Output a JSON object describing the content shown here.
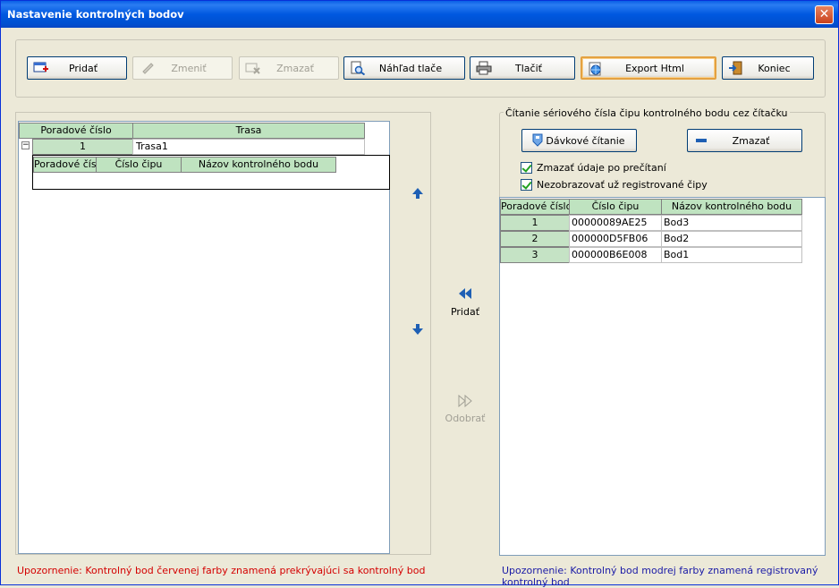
{
  "window": {
    "title": "Nastavenie kontrolných bodov"
  },
  "toolbar": {
    "add": "Pridať",
    "edit": "Zmeniť",
    "delete": "Zmazať",
    "preview": "Náhľad tlače",
    "print": "Tlačiť",
    "export": "Export Html",
    "exit": "Koniec"
  },
  "left_grid": {
    "headers": [
      "Poradové číslo",
      "Trasa"
    ],
    "rows": [
      {
        "index": "1",
        "route": "Trasa1"
      }
    ],
    "sub_headers": [
      "Poradové čís",
      "Číslo čipu",
      "Názov kontrolného bodu"
    ]
  },
  "middle": {
    "add_label": "Pridať",
    "remove_label": "Odobrať"
  },
  "reader": {
    "group_title": "Čítanie sériového čísla čipu kontrolného bodu cez čítačku",
    "batch_read": "Dávkové čítanie",
    "clear": "Zmazať",
    "check_clear": "Zmazať údaje po prečítaní",
    "check_hide": "Nezobrazovať už registrované čipy",
    "headers": [
      "Poradové číslo",
      "Číslo čipu",
      "Názov kontrolného bodu"
    ],
    "rows": [
      {
        "index": "1",
        "chip": "00000089AE25",
        "name": "Bod3"
      },
      {
        "index": "2",
        "chip": "000000D5FB06",
        "name": "Bod2"
      },
      {
        "index": "3",
        "chip": "000000B6E008",
        "name": "Bod1"
      }
    ]
  },
  "notes": {
    "red": "Upozornenie: Kontrolný bod červenej farby znamená prekrývajúci sa kontrolný bod",
    "blue": "Upozornenie: Kontrolný bod modrej farby znamená registrovaný kontrolný bod"
  },
  "colors": {
    "header_bg": "#bfe3c0",
    "accent_blue": "#1e5fb4",
    "warn_red": "#d40000",
    "warn_blue": "#1a1aa6"
  }
}
